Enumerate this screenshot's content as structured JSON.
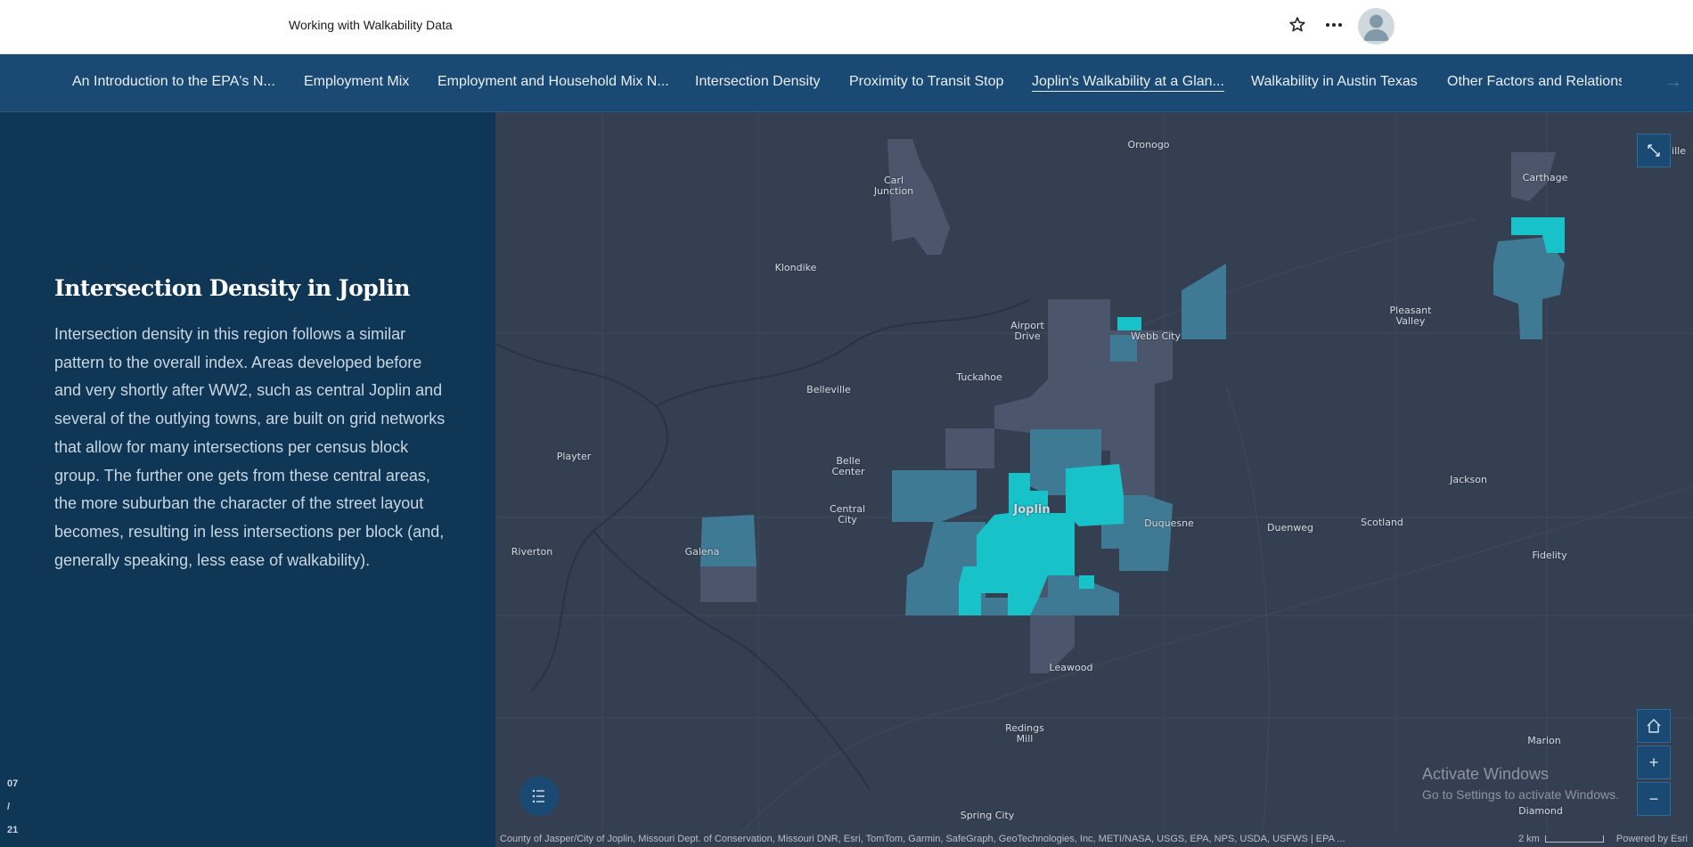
{
  "header": {
    "title": "Working with Walkability Data"
  },
  "tabs": [
    {
      "label": "An Introduction to the EPA's N..."
    },
    {
      "label": "Employment Mix"
    },
    {
      "label": "Employment and Household Mix N..."
    },
    {
      "label": "Intersection Density"
    },
    {
      "label": "Proximity to Transit Stop"
    },
    {
      "label": "Joplin's Walkability at a Glan..."
    },
    {
      "label": "Walkability in Austin Texas"
    },
    {
      "label": "Other Factors and Relations"
    }
  ],
  "active_tab": "Joplin's Walkability at a Glan...",
  "sidebar": {
    "heading": "Intersection Density in Joplin",
    "body": "Intersection density in this region follows a similar pattern to the overall index. Areas developed before and very shortly after WW2, such as central Joplin and several of the outlying towns, are built on grid networks that allow for many intersections per census block group. The further one gets from these central areas, the more suburban the character of the street layout becomes, resulting in less intersections per block (and, generally speaking, less ease of walkability).",
    "counter": {
      "current": "07",
      "separator": "/",
      "total": "21"
    }
  },
  "map": {
    "places": [
      {
        "name": "Oronogo"
      },
      {
        "name": "Carl\nJunction"
      },
      {
        "name": "Carthage"
      },
      {
        "name": "Klondike"
      },
      {
        "name": "Airport\nDrive"
      },
      {
        "name": "Webb City"
      },
      {
        "name": "Pleasant\nValley"
      },
      {
        "name": "Tuckahoe"
      },
      {
        "name": "Belleville"
      },
      {
        "name": "Playter"
      },
      {
        "name": "Belle\nCenter"
      },
      {
        "name": "Joplin"
      },
      {
        "name": "Central\nCity"
      },
      {
        "name": "Jackson"
      },
      {
        "name": "Riverton"
      },
      {
        "name": "Galena"
      },
      {
        "name": "Duquesne"
      },
      {
        "name": "Duenweg"
      },
      {
        "name": "Scotland"
      },
      {
        "name": "Fidelity"
      },
      {
        "name": "Leawood"
      },
      {
        "name": "Redings\nMill"
      },
      {
        "name": "Marion"
      },
      {
        "name": "Spring City"
      },
      {
        "name": "Diamond"
      },
      {
        "name": "ille"
      }
    ],
    "colors": {
      "high": "#17c3c9",
      "mid": "#3f7a95",
      "low": "#4b566c",
      "base": "#343f51"
    },
    "controls": {
      "zoom_in": "+",
      "zoom_out": "−"
    },
    "attribution": "County of Jasper/City of Joplin, Missouri Dept. of Conservation, Missouri DNR, Esri, TomTom, Garmin, SafeGraph, GeoTechnologies, Inc, METI/NASA, USGS, EPA, NPS, USDA, USFWS | EPA ...",
    "scale_label": "2 km",
    "powered_by": "Powered by Esri"
  },
  "watermark": {
    "line1": "Activate Windows",
    "line2": "Go to Settings to activate Windows."
  }
}
